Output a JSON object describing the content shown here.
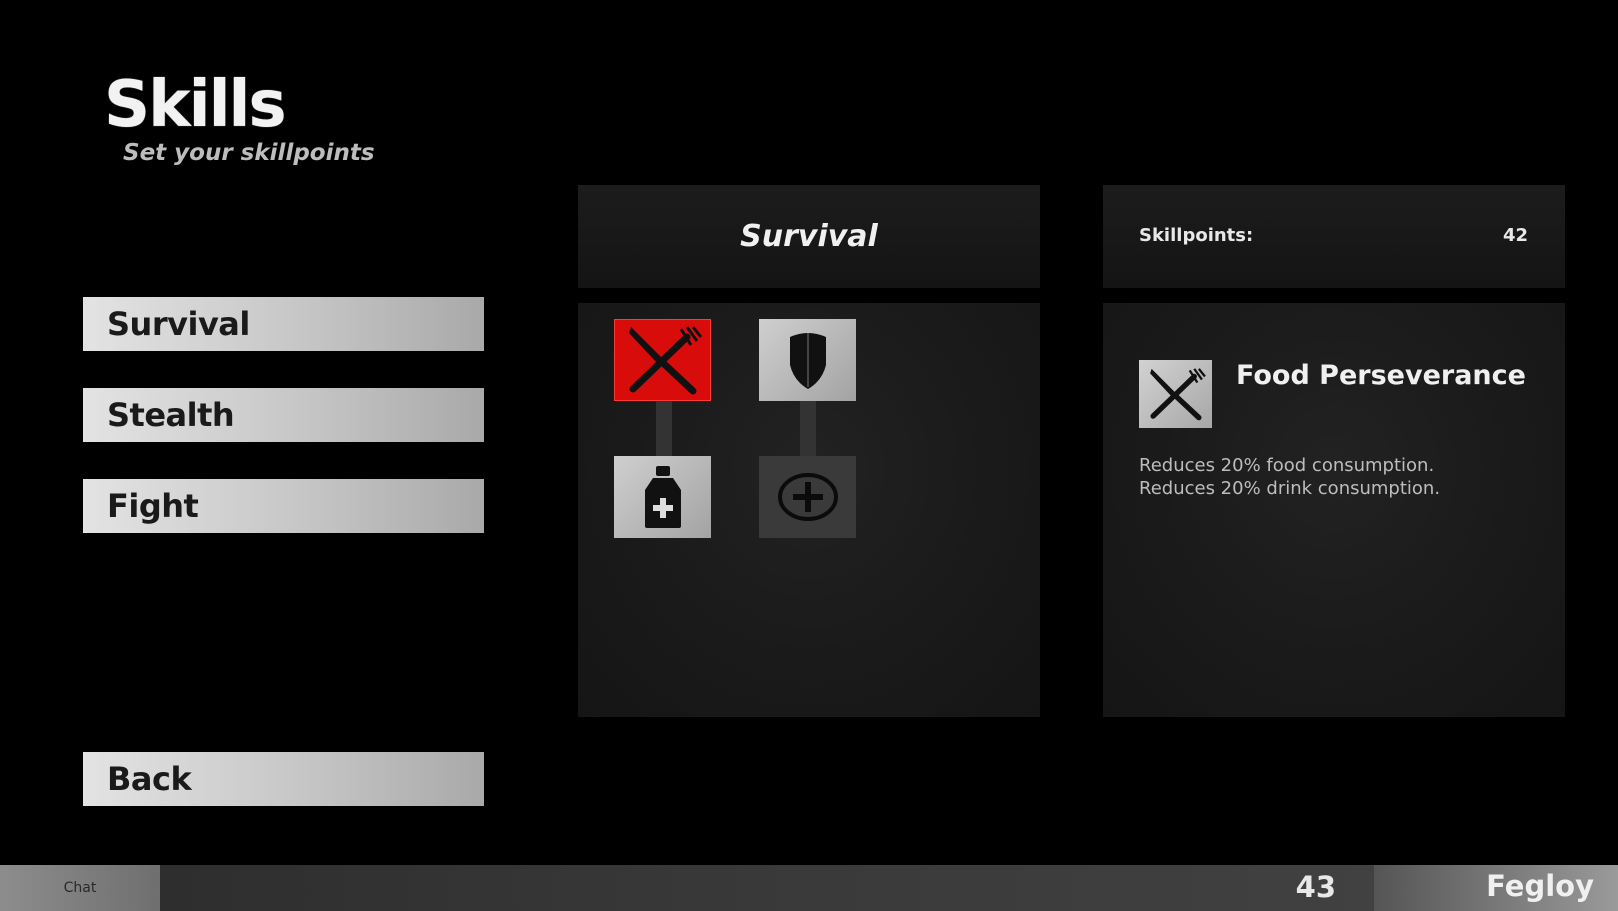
{
  "header": {
    "title": "Skills",
    "subtitle": "Set your skillpoints"
  },
  "menu": {
    "items": [
      {
        "label": "Survival"
      },
      {
        "label": "Stealth"
      },
      {
        "label": "Fight"
      }
    ],
    "back_label": "Back"
  },
  "tree": {
    "title": "Survival",
    "skills": [
      {
        "icon": "fork-knife-icon",
        "state": "selected"
      },
      {
        "icon": "shield-icon",
        "state": "unlocked"
      },
      {
        "icon": "medicine-bottle-icon",
        "state": "unlocked"
      },
      {
        "icon": "plus-circle-icon",
        "state": "locked"
      }
    ]
  },
  "skillpoints": {
    "label": "Skillpoints:",
    "value": "42"
  },
  "detail": {
    "icon": "fork-knife-icon",
    "name": "Food Perseverance",
    "lines": [
      "Reduces 20% food consumption.",
      "Reduces 20% drink consumption."
    ]
  },
  "footer": {
    "chat_label": "Chat",
    "count": "43",
    "player_name": "Fegloy"
  },
  "colors": {
    "selected_tile": "#d90c0c",
    "background": "#000000"
  }
}
